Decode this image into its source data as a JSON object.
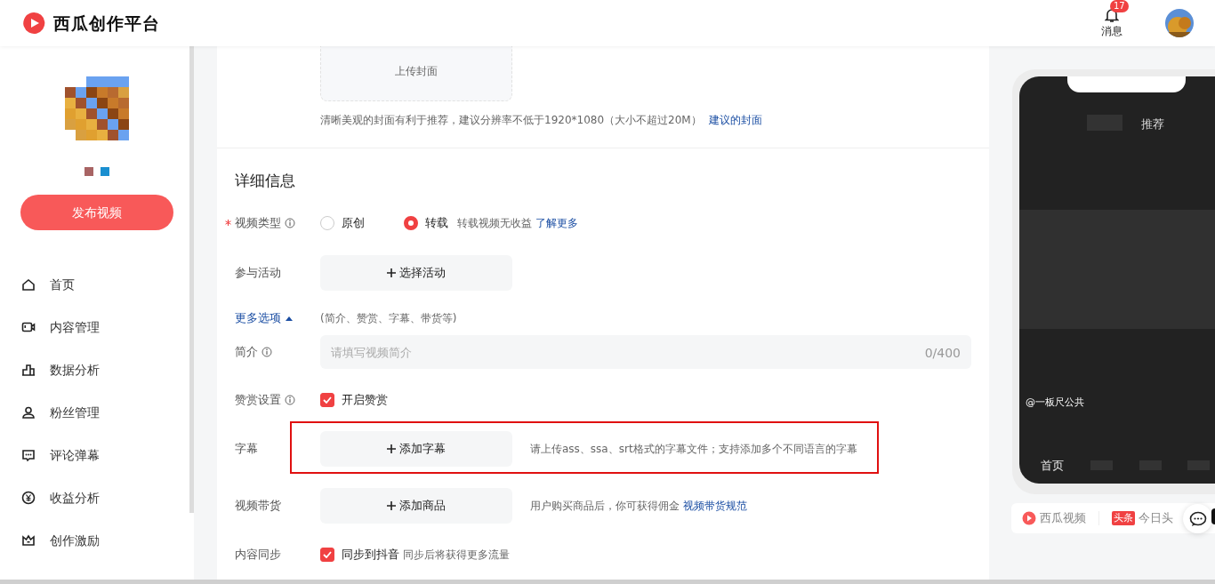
{
  "header": {
    "logo": "西瓜创作平台",
    "notifications": {
      "label": "消息",
      "count": "17"
    }
  },
  "sidebar": {
    "publish_button": "发布视频",
    "items": [
      {
        "label": "首页",
        "selected": false
      },
      {
        "label": "内容管理",
        "selected": false
      },
      {
        "label": "数据分析",
        "selected": false
      },
      {
        "label": "粉丝管理",
        "selected": false
      },
      {
        "label": "评论弹幕",
        "selected": false
      },
      {
        "label": "收益分析",
        "selected": false
      },
      {
        "label": "创作激励",
        "selected": false
      }
    ]
  },
  "cover": {
    "upload_label": "上传封面",
    "hint": "清晰美观的封面有利于推荐，建议分辨率不低于1920*1080（大小不超过20M）",
    "link": "建议的封面"
  },
  "details": {
    "title": "详细信息",
    "video_type": {
      "label": "视频类型",
      "required": true,
      "options": [
        {
          "label": "原创",
          "selected": false
        },
        {
          "label": "转载",
          "selected": true
        }
      ],
      "note": "转载视频无收益",
      "link": "了解更多"
    },
    "activity": {
      "label": "参与活动",
      "button": "选择活动"
    },
    "more_options": {
      "label": "更多选项",
      "expanded": true,
      "note": "(简介、赞赏、字幕、带货等)"
    },
    "intro": {
      "label": "简介",
      "placeholder": "请填写视频简介",
      "counter": "0/400"
    },
    "reward": {
      "label": "赞赏设置",
      "checkbox": "开启赞赏",
      "checked": true
    },
    "subtitle": {
      "label": "字幕",
      "button": "添加字幕",
      "hint": "请上传ass、ssa、srt格式的字幕文件；支持添加多个不同语言的字幕",
      "highlighted": true
    },
    "goods": {
      "label": "视频带货",
      "button": "添加商品",
      "hint": "用户购买商品后，你可获得佣金",
      "link": "视频带货规范"
    },
    "sync": {
      "label": "内容同步",
      "checkbox": "同步到抖音",
      "checked": true,
      "note": "同步后将获得更多流量"
    }
  },
  "preview": {
    "tab": "推荐",
    "author": "@一板尺公共",
    "nav_first": "首页",
    "platforms": [
      {
        "kind": "xigua",
        "name": "西瓜视频"
      },
      {
        "kind": "toutiao",
        "badge": "头条",
        "name": "今日头"
      }
    ]
  }
}
